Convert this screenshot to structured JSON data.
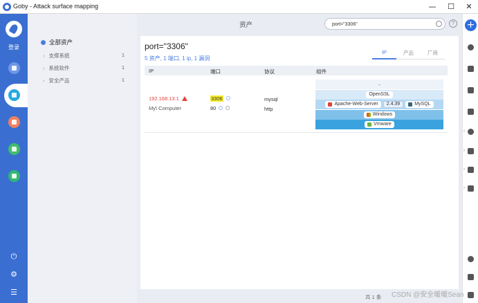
{
  "window": {
    "title": "Goby - Attack surface mapping",
    "minimize": "—",
    "maximize": "☐",
    "close": "✕"
  },
  "sidebar": {
    "login": "登录"
  },
  "categories": {
    "all": "全部资产",
    "items": [
      {
        "label": "支撑系统",
        "count": "1"
      },
      {
        "label": "系统软件",
        "count": "1"
      },
      {
        "label": "安全产品",
        "count": "1"
      }
    ]
  },
  "header": {
    "title": "资产",
    "search_value": "port=\"3306\"",
    "help": "?"
  },
  "result": {
    "query": "port=\"3306\"",
    "summary": "5 资产, 1 端口, 1 ip, 1 漏洞",
    "tabs": [
      "IP",
      "产品",
      "厂商"
    ],
    "columns": [
      "IP",
      "端口",
      "协议",
      "组件"
    ],
    "row": {
      "ip": "192.168.13.1",
      "hostname": "My\\ Computer",
      "ports": [
        "3306",
        "80"
      ],
      "protocols": [
        "mysql",
        "http"
      ],
      "components": {
        "dash": "-",
        "openssl": "OpenSSL",
        "apache": "Apache-Web-Server",
        "apache_version": "2.4.39",
        "mysql": "MySQL",
        "windows": "Windows",
        "vmware": "Vmware"
      }
    }
  },
  "footer": {
    "pager": "共 1 条",
    "watermark": "CSDN @安全暖暖Sean"
  },
  "colors": {
    "accent": "#3a6fd1",
    "warn": "#e0443c",
    "highlight": "#f7ec2d"
  }
}
